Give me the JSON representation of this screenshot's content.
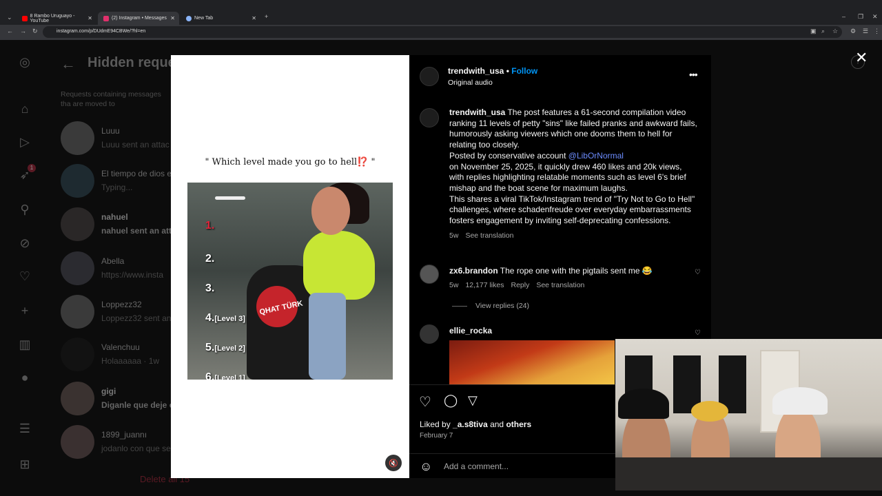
{
  "browser": {
    "tabs": [
      {
        "title": "8 Rambo Uruguayo - YouTube",
        "favicon_color": "#ff0000",
        "active": false
      },
      {
        "title": "(2) Instagram • Messages",
        "favicon_color": "#e1306c",
        "active": true
      },
      {
        "title": "New Tab",
        "favicon_color": "#8ab4f8",
        "active": false
      }
    ],
    "new_tab": "+",
    "url": "instagram.com/p/DUdmE94CBWe/?hl=en"
  },
  "sidebar_badge": "1",
  "dm": {
    "back_icon": "←",
    "title": "Hidden reque",
    "description": "Requests containing messages tha are moved to",
    "items": [
      {
        "name": "Luuu",
        "sub": "Luuu sent an attac"
      },
      {
        "name": "El tiempo de dios e",
        "sub": "Typing..."
      },
      {
        "name": "nahuel",
        "sub": "nahuel sent an att"
      },
      {
        "name": "Abella",
        "sub": "https://www.insta"
      },
      {
        "name": "Loppezz32",
        "sub": "Loppezz32 sent an"
      },
      {
        "name": "Valenchuu",
        "sub": "Holaaaaaa · 1w"
      },
      {
        "name": "gigi",
        "sub": "Diganle que deje c"
      },
      {
        "name": "1899_juannı",
        "sub": "jodanlo con que se"
      }
    ],
    "delete_all": "Delete all 15"
  },
  "video": {
    "caption": "\" Which level made you go to hell⁉️ \"",
    "levels": [
      {
        "num": "1.",
        "label": ""
      },
      {
        "num": "2.",
        "label": ""
      },
      {
        "num": "3.",
        "label": ""
      },
      {
        "num": "4.",
        "label": "[Level 3]"
      },
      {
        "num": "5.",
        "label": "[Level 2]"
      },
      {
        "num": "6.",
        "label": "[Level 1]"
      }
    ],
    "bike_text": "QHAT TÜRK",
    "sound_icon": "🔇"
  },
  "post": {
    "username": "trendwith_usa",
    "dot": " • ",
    "follow": "Follow",
    "audio": "Original audio",
    "more_icon": "•••",
    "caption_user": "trendwith_usa",
    "caption_1": " The post features a 61-second compilation video ranking 11 levels of petty \"sins\" like failed pranks and awkward fails, humorously asking viewers which one dooms them to hell for relating too closely.",
    "caption_2_pre": "Posted by conservative account ",
    "caption_mention": "@LibOrNormal",
    "caption_2_post": "on November 25, 2025, it quickly drew 460 likes and 20k views, with replies highlighting relatable moments such as level 6's brief mishap and the boat scene for maximum laughs.",
    "caption_3": "This shares a viral TikTok/Instagram trend of \"Try Not to Go to Hell\" challenges, where schadenfreude over everyday embarrassments fosters engagement by inviting self-deprecating confessions.",
    "caption_time": "5w",
    "see_translation": "See translation",
    "comments": [
      {
        "user": "zx6.brandon",
        "text": " The rope one with the pigtails sent me 😂",
        "time": "5w",
        "likes": "12,177 likes",
        "reply": "Reply",
        "translation": "See translation"
      },
      {
        "user": "ellie_rocka",
        "text": ""
      }
    ],
    "view_replies": "View replies (24)",
    "liked_by_pre": "Liked by ",
    "liked_by_user": "_a.s8tiva",
    "liked_by_mid": " and ",
    "liked_by_others": "others",
    "date": "February 7",
    "add_comment": "Add a comment..."
  },
  "icons": {
    "heart": "♡",
    "comment": "◯",
    "share": "▽",
    "emoji": "☺",
    "close": "✕",
    "info": "i"
  }
}
